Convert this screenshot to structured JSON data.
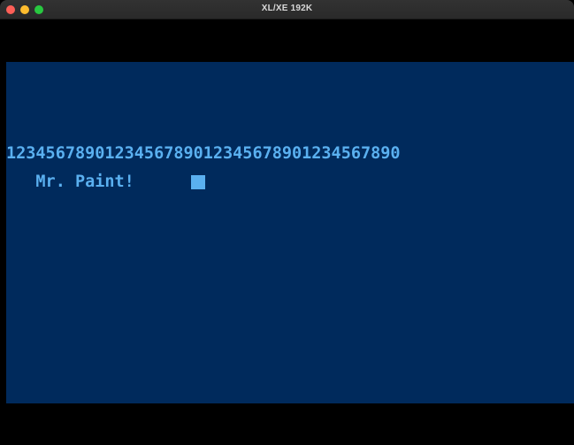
{
  "window": {
    "title": "XL/XE 192K",
    "buttons": {
      "close_color": "#fe5f57",
      "minimize_color": "#febc2e",
      "zoom_color": "#28c840"
    }
  },
  "screen": {
    "background_color": "#002a5c",
    "text_color": "#5ab0f0",
    "lines": [
      "1234567890123456789012345678901234567890",
      "   Mr. Paint!"
    ]
  }
}
